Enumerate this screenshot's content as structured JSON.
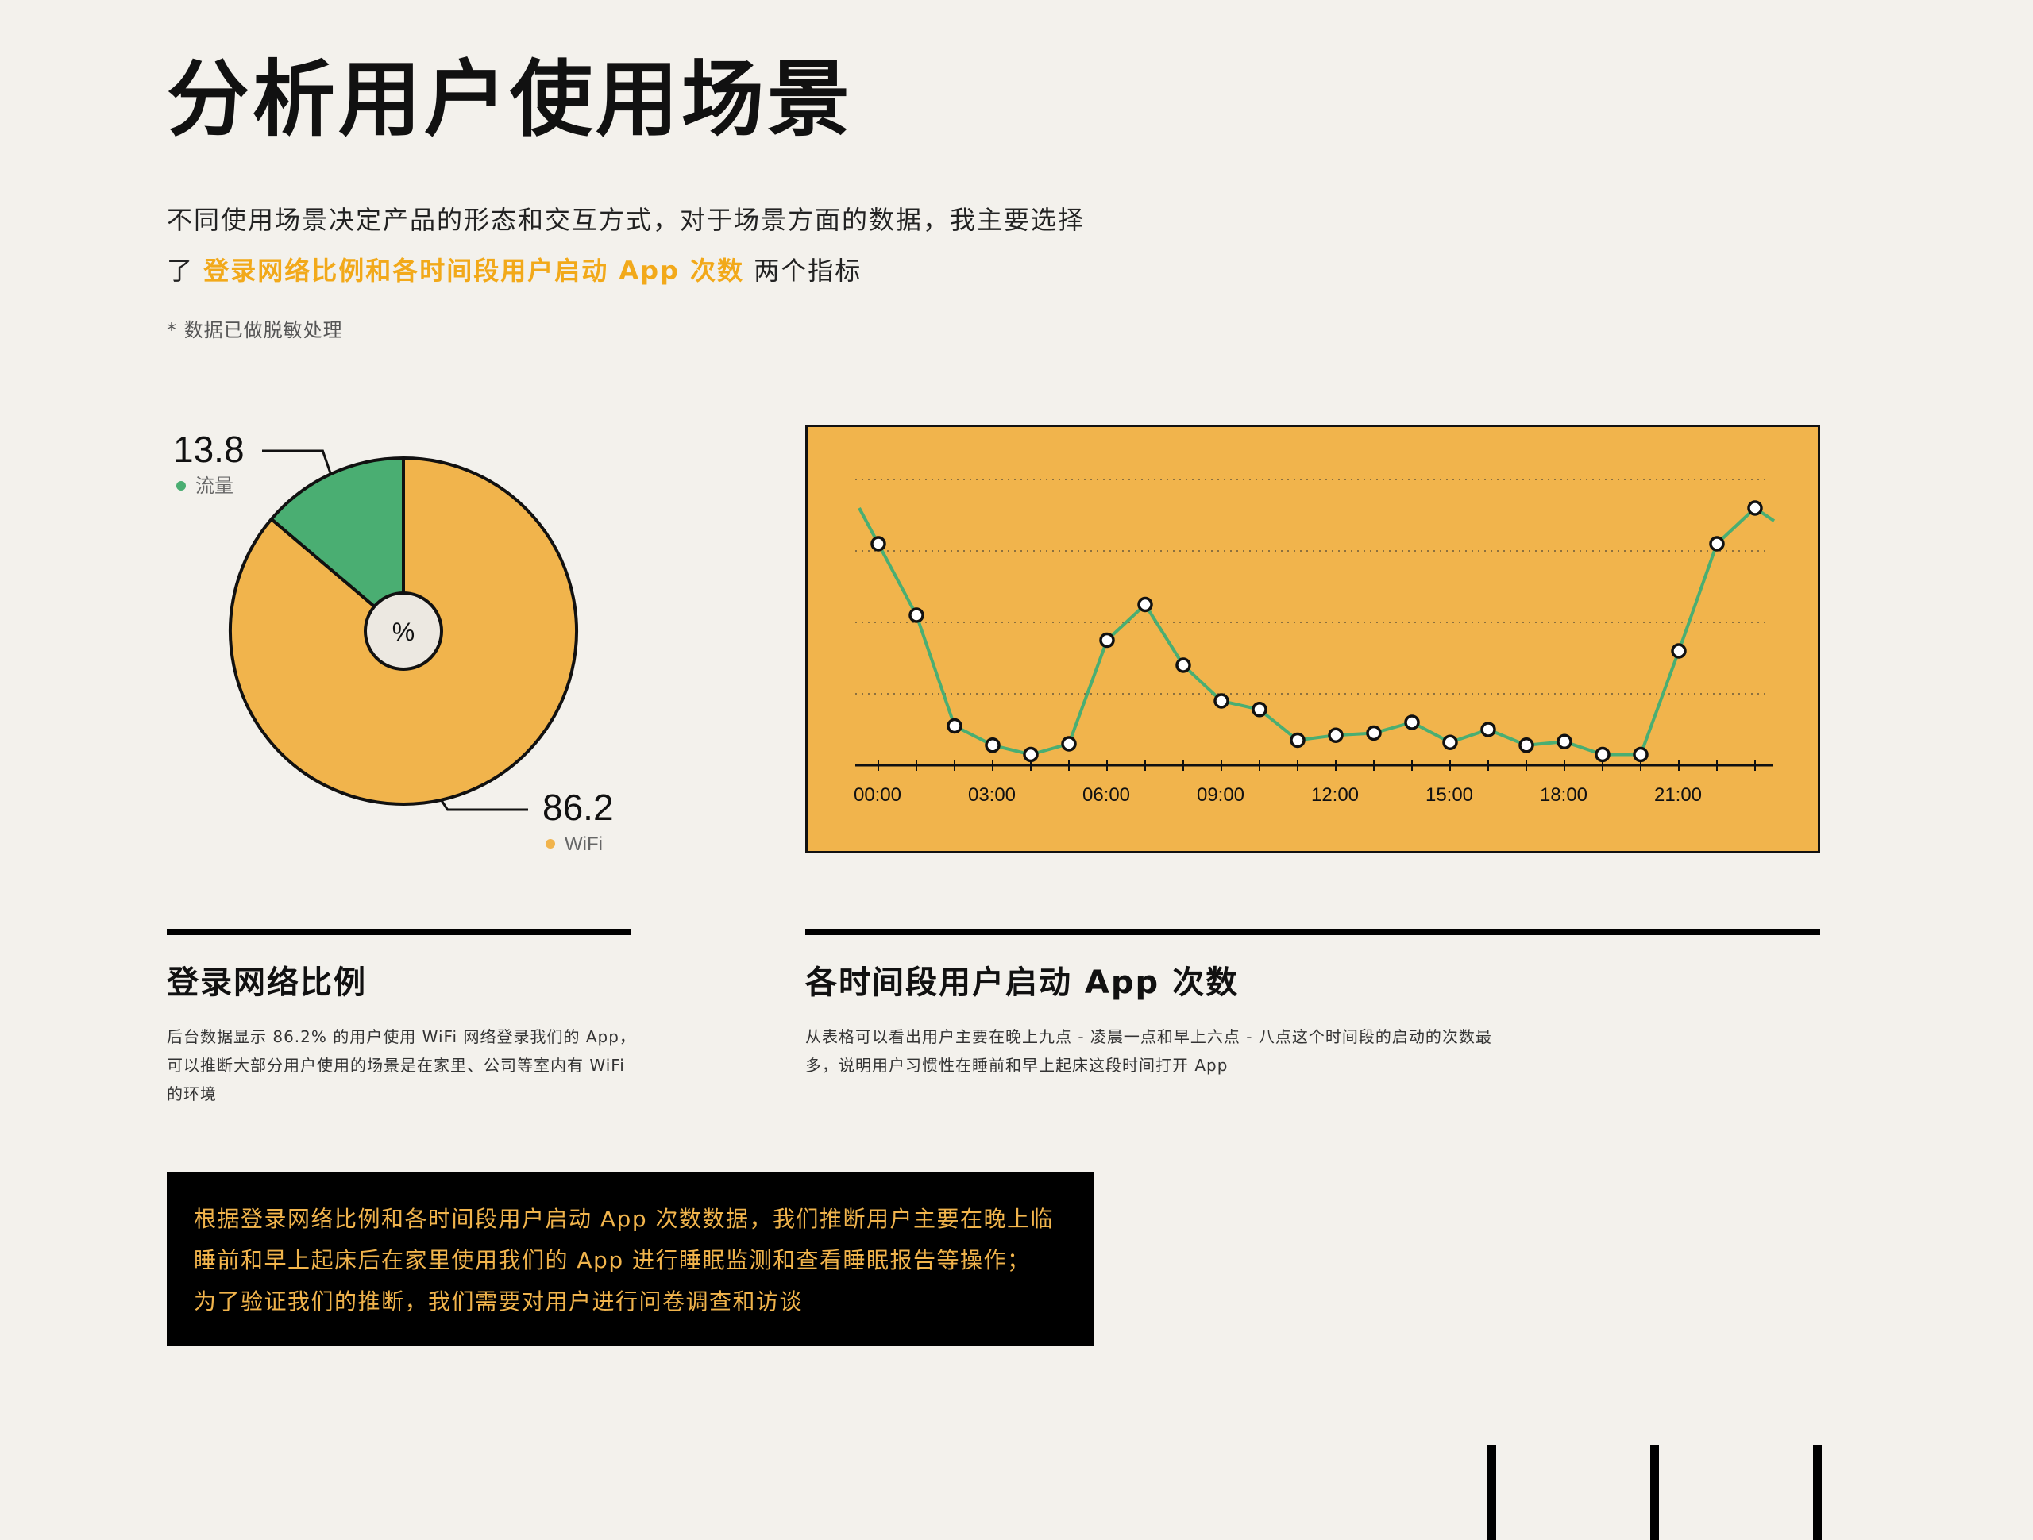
{
  "header": {
    "title": "分析用户使用场景",
    "intro_line1": "不同使用场景决定产品的形态和交互方式，对于场景方面的数据，我主要选择",
    "intro_line2_prefix": "了 ",
    "intro_line2_highlight": "登录网络比例和各时间段用户启动 App 次数",
    "intro_line2_suffix": " 两个指标",
    "footnote": "* 数据已做脱敏处理"
  },
  "colors": {
    "background": "#f3f1ec",
    "accent_yellow": "#f1b44c",
    "accent_green": "#4aae72",
    "text_black": "#111111"
  },
  "chart_data": [
    {
      "type": "pie",
      "center_label": "%",
      "slices": [
        {
          "label": "流量",
          "value": 13.8,
          "color": "#4aae72"
        },
        {
          "label": "WiFi",
          "value": 86.2,
          "color": "#f1b44c"
        }
      ]
    },
    {
      "type": "line",
      "x_tick_labels": [
        "00:00",
        "03:00",
        "06:00",
        "09:00",
        "12:00",
        "15:00",
        "18:00",
        "21:00"
      ],
      "x": [
        0,
        1,
        2,
        3,
        4,
        5,
        6,
        7,
        8,
        9,
        10,
        11,
        12,
        13,
        14,
        15,
        16,
        17,
        18,
        19,
        20,
        21,
        22,
        23
      ],
      "y": [
        3.1,
        2.1,
        0.55,
        0.28,
        0.15,
        0.3,
        1.75,
        2.25,
        1.4,
        0.9,
        0.78,
        0.35,
        0.42,
        0.45,
        0.6,
        0.32,
        0.5,
        0.28,
        0.33,
        0.15,
        0.15,
        1.6,
        3.1,
        3.6
      ],
      "ylim": [
        0,
        4
      ],
      "grid": "horizontal-dotted",
      "line_color": "#4aae72",
      "background": "#f1b44c"
    }
  ],
  "sections": {
    "left": {
      "title": "登录网络比例",
      "body_lines": [
        "后台数据显示 86.2% 的用户使用 WiFi 网络登录我们的 App，",
        "可以推断大部分用户使用的场景是在家里、公司等室内有 WiFi",
        "的环境"
      ]
    },
    "right": {
      "title": "各时间段用户启动 App 次数",
      "body_lines": [
        "从表格可以看出用户主要在晚上九点 - 凌晨一点和早上六点 - 八点这个时间段的启动的次数最",
        "多，说明用户习惯性在睡前和早上起床这段时间打开 App"
      ]
    }
  },
  "conclusion": {
    "lines": [
      "根据登录网络比例和各时间段用户启动 App 次数数据，我们推断用户主要在晚上临",
      "睡前和早上起床后在家里使用我们的 App 进行睡眠监测和查看睡眠报告等操作；",
      "为了验证我们的推断，我们需要对用户进行问卷调查和访谈"
    ]
  }
}
